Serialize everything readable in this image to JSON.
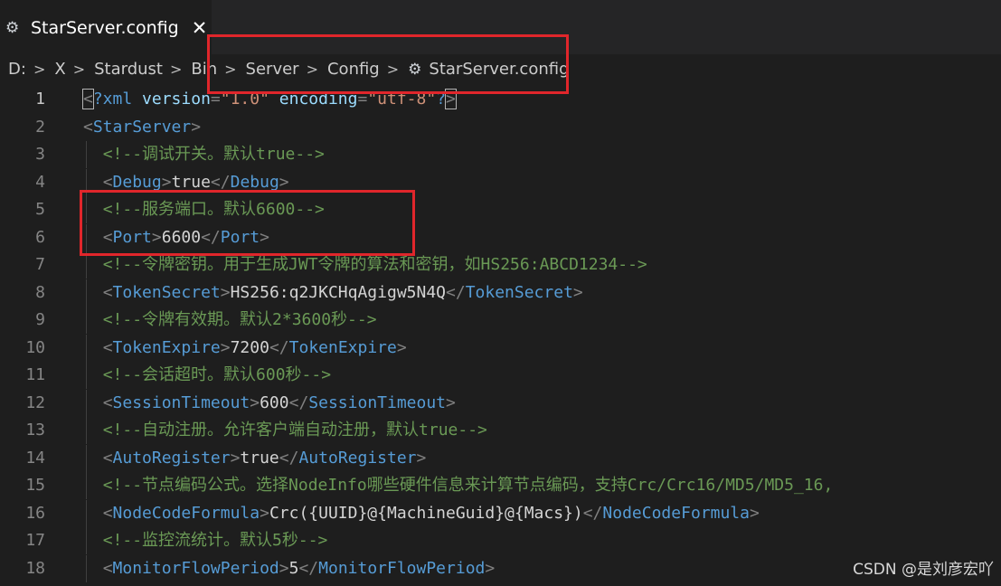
{
  "tab": {
    "title": "StarServer.config",
    "close_glyph": "✕",
    "icon": "gear-icon"
  },
  "breadcrumb": {
    "items": [
      "D:",
      "X",
      "Stardust",
      "Bin",
      "Server",
      "Config",
      "StarServer.config"
    ],
    "separator": ">"
  },
  "editor": {
    "lines": [
      {
        "n": "1",
        "parts": [
          [
            "punc",
            "<"
          ],
          [
            "tag",
            "?xml"
          ],
          [
            "txt",
            " "
          ],
          [
            "attr",
            "version"
          ],
          [
            "punc",
            "="
          ],
          [
            "str",
            "\"1.0\""
          ],
          [
            "txt",
            " "
          ],
          [
            "attr",
            "encoding"
          ],
          [
            "punc",
            "="
          ],
          [
            "str",
            "\"utf-8\""
          ],
          [
            "tag",
            "?"
          ],
          [
            "punc",
            ">"
          ]
        ]
      },
      {
        "n": "2",
        "parts": [
          [
            "punc",
            "<"
          ],
          [
            "tag",
            "StarServer"
          ],
          [
            "punc",
            ">"
          ]
        ]
      },
      {
        "n": "3",
        "parts": [
          [
            "txt",
            "  "
          ],
          [
            "cmt",
            "<!--调试开关。默认true-->"
          ]
        ]
      },
      {
        "n": "4",
        "parts": [
          [
            "txt",
            "  "
          ],
          [
            "punc",
            "<"
          ],
          [
            "tag",
            "Debug"
          ],
          [
            "punc",
            ">"
          ],
          [
            "txt",
            "true"
          ],
          [
            "punc",
            "</"
          ],
          [
            "tag",
            "Debug"
          ],
          [
            "punc",
            ">"
          ]
        ]
      },
      {
        "n": "5",
        "parts": [
          [
            "txt",
            "  "
          ],
          [
            "cmt",
            "<!--服务端口。默认6600-->"
          ]
        ]
      },
      {
        "n": "6",
        "parts": [
          [
            "txt",
            "  "
          ],
          [
            "punc",
            "<"
          ],
          [
            "tag",
            "Port"
          ],
          [
            "punc",
            ">"
          ],
          [
            "txt",
            "6600"
          ],
          [
            "punc",
            "</"
          ],
          [
            "tag",
            "Port"
          ],
          [
            "punc",
            ">"
          ]
        ]
      },
      {
        "n": "7",
        "parts": [
          [
            "txt",
            "  "
          ],
          [
            "cmt",
            "<!--令牌密钥。用于生成JWT令牌的算法和密钥，如HS256:ABCD1234-->"
          ]
        ]
      },
      {
        "n": "8",
        "parts": [
          [
            "txt",
            "  "
          ],
          [
            "punc",
            "<"
          ],
          [
            "tag",
            "TokenSecret"
          ],
          [
            "punc",
            ">"
          ],
          [
            "txt",
            "HS256:q2JKCHqAgigw5N4Q"
          ],
          [
            "punc",
            "</"
          ],
          [
            "tag",
            "TokenSecret"
          ],
          [
            "punc",
            ">"
          ]
        ]
      },
      {
        "n": "9",
        "parts": [
          [
            "txt",
            "  "
          ],
          [
            "cmt",
            "<!--令牌有效期。默认2*3600秒-->"
          ]
        ]
      },
      {
        "n": "10",
        "parts": [
          [
            "txt",
            "  "
          ],
          [
            "punc",
            "<"
          ],
          [
            "tag",
            "TokenExpire"
          ],
          [
            "punc",
            ">"
          ],
          [
            "txt",
            "7200"
          ],
          [
            "punc",
            "</"
          ],
          [
            "tag",
            "TokenExpire"
          ],
          [
            "punc",
            ">"
          ]
        ]
      },
      {
        "n": "11",
        "parts": [
          [
            "txt",
            "  "
          ],
          [
            "cmt",
            "<!--会话超时。默认600秒-->"
          ]
        ]
      },
      {
        "n": "12",
        "parts": [
          [
            "txt",
            "  "
          ],
          [
            "punc",
            "<"
          ],
          [
            "tag",
            "SessionTimeout"
          ],
          [
            "punc",
            ">"
          ],
          [
            "txt",
            "600"
          ],
          [
            "punc",
            "</"
          ],
          [
            "tag",
            "SessionTimeout"
          ],
          [
            "punc",
            ">"
          ]
        ]
      },
      {
        "n": "13",
        "parts": [
          [
            "txt",
            "  "
          ],
          [
            "cmt",
            "<!--自动注册。允许客户端自动注册，默认true-->"
          ]
        ]
      },
      {
        "n": "14",
        "parts": [
          [
            "txt",
            "  "
          ],
          [
            "punc",
            "<"
          ],
          [
            "tag",
            "AutoRegister"
          ],
          [
            "punc",
            ">"
          ],
          [
            "txt",
            "true"
          ],
          [
            "punc",
            "</"
          ],
          [
            "tag",
            "AutoRegister"
          ],
          [
            "punc",
            ">"
          ]
        ]
      },
      {
        "n": "15",
        "parts": [
          [
            "txt",
            "  "
          ],
          [
            "cmt",
            "<!--节点编码公式。选择NodeInfo哪些硬件信息来计算节点编码，支持Crc/Crc16/MD5/MD5_16,"
          ]
        ]
      },
      {
        "n": "16",
        "parts": [
          [
            "txt",
            "  "
          ],
          [
            "punc",
            "<"
          ],
          [
            "tag",
            "NodeCodeFormula"
          ],
          [
            "punc",
            ">"
          ],
          [
            "txt",
            "Crc({UUID}@{MachineGuid}@{Macs})"
          ],
          [
            "punc",
            "</"
          ],
          [
            "tag",
            "NodeCodeFormula"
          ],
          [
            "punc",
            ">"
          ]
        ]
      },
      {
        "n": "17",
        "parts": [
          [
            "txt",
            "  "
          ],
          [
            "cmt",
            "<!--监控流统计。默认5秒-->"
          ]
        ]
      },
      {
        "n": "18",
        "parts": [
          [
            "txt",
            "  "
          ],
          [
            "punc",
            "<"
          ],
          [
            "tag",
            "MonitorFlowPeriod"
          ],
          [
            "punc",
            ">"
          ],
          [
            "txt",
            "5"
          ],
          [
            "punc",
            "</"
          ],
          [
            "tag",
            "MonitorFlowPeriod"
          ],
          [
            "punc",
            ">"
          ]
        ]
      }
    ]
  },
  "watermark": "CSDN @是刘彦宏吖",
  "colors": {
    "highlight": "#e0262b",
    "tag": "#569cd6",
    "comment": "#6a9955",
    "string": "#ce9178",
    "attribute": "#9cdcfe"
  }
}
